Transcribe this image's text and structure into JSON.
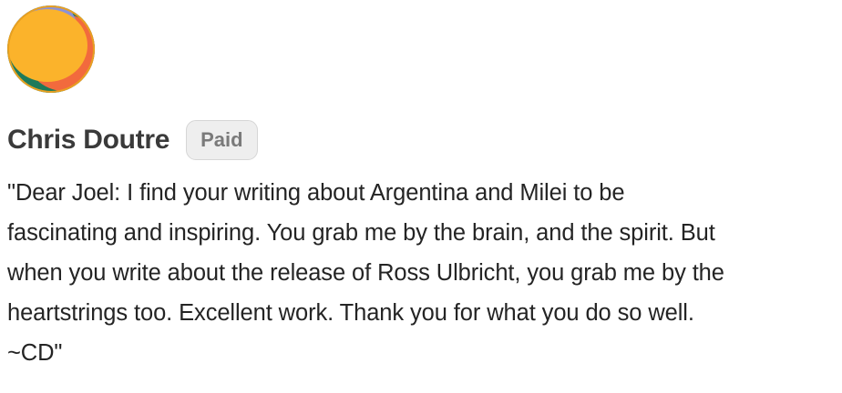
{
  "comment": {
    "author": "Chris Doutre",
    "badge": "Paid",
    "avatar": {
      "icon": "avatar-abstract-circles",
      "colors": [
        "#FBB32B",
        "#F26A3D",
        "#1E7A5A",
        "#8C92D6"
      ]
    },
    "text_lines": [
      "\"Dear Joel: I find your writing about Argentina and Milei to be",
      "fascinating and inspiring. You grab me by the brain, and the spirit. But",
      "when you write about the release of Ross Ulbricht, you grab me by the",
      "heartstrings too. Excellent work. Thank you for what you do so well.",
      "~CD\""
    ]
  }
}
